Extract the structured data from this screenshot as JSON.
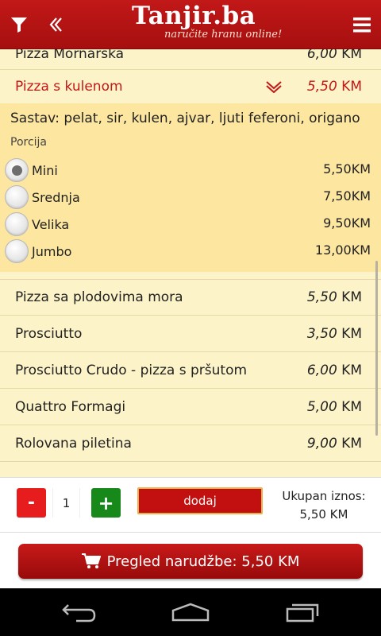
{
  "header": {
    "brand": "Tanjir.ba",
    "tagline": "naručite hranu online!"
  },
  "items": [
    {
      "name": "Pizza Mornarska",
      "price": "6,00",
      "currency": "KM"
    },
    {
      "name": "Pizza s kulenom",
      "price": "5,50",
      "currency": "KM"
    },
    {
      "name": "Pizza sa plodovima mora",
      "price": "5,50",
      "currency": "KM"
    },
    {
      "name": "Prosciutto",
      "price": "3,50",
      "currency": "KM"
    },
    {
      "name": "Prosciutto Crudo - pizza s pršutom",
      "price": "6,00",
      "currency": "KM"
    },
    {
      "name": "Quattro Formagi",
      "price": "5,00",
      "currency": "KM"
    },
    {
      "name": "Rolovana piletina",
      "price": "9,00",
      "currency": "KM"
    }
  ],
  "detail": {
    "sastav": "Sastav: pelat, sir, kulen, ajvar, ljuti feferoni, origano",
    "porcija_label": "Porcija",
    "options": [
      {
        "label": "Mini",
        "price": "5,50KM",
        "selected": true
      },
      {
        "label": "Srednja",
        "price": "7,50KM",
        "selected": false
      },
      {
        "label": "Velika",
        "price": "9,50KM",
        "selected": false
      },
      {
        "label": "Jumbo",
        "price": "13,00KM",
        "selected": false
      }
    ]
  },
  "cart": {
    "minus_label": "-",
    "quantity": "1",
    "plus_label": "+",
    "add_label": "dodaj",
    "total_label": "Ukupan iznos:",
    "total_value": "5,50 KM"
  },
  "order_button": "Pregled narudžbe: 5,50 KM",
  "colors": {
    "brand_red": "#b01212",
    "list_bg": "#fdf3c9",
    "expanded_bg": "#fde7a0",
    "add_green": "#17891a",
    "minus_red": "#e71d1d"
  },
  "icons": [
    "filter-icon",
    "back-icon",
    "menu-icon",
    "chevron-down-icon",
    "cart-icon",
    "nav-back-icon",
    "nav-home-icon",
    "nav-recents-icon"
  ]
}
